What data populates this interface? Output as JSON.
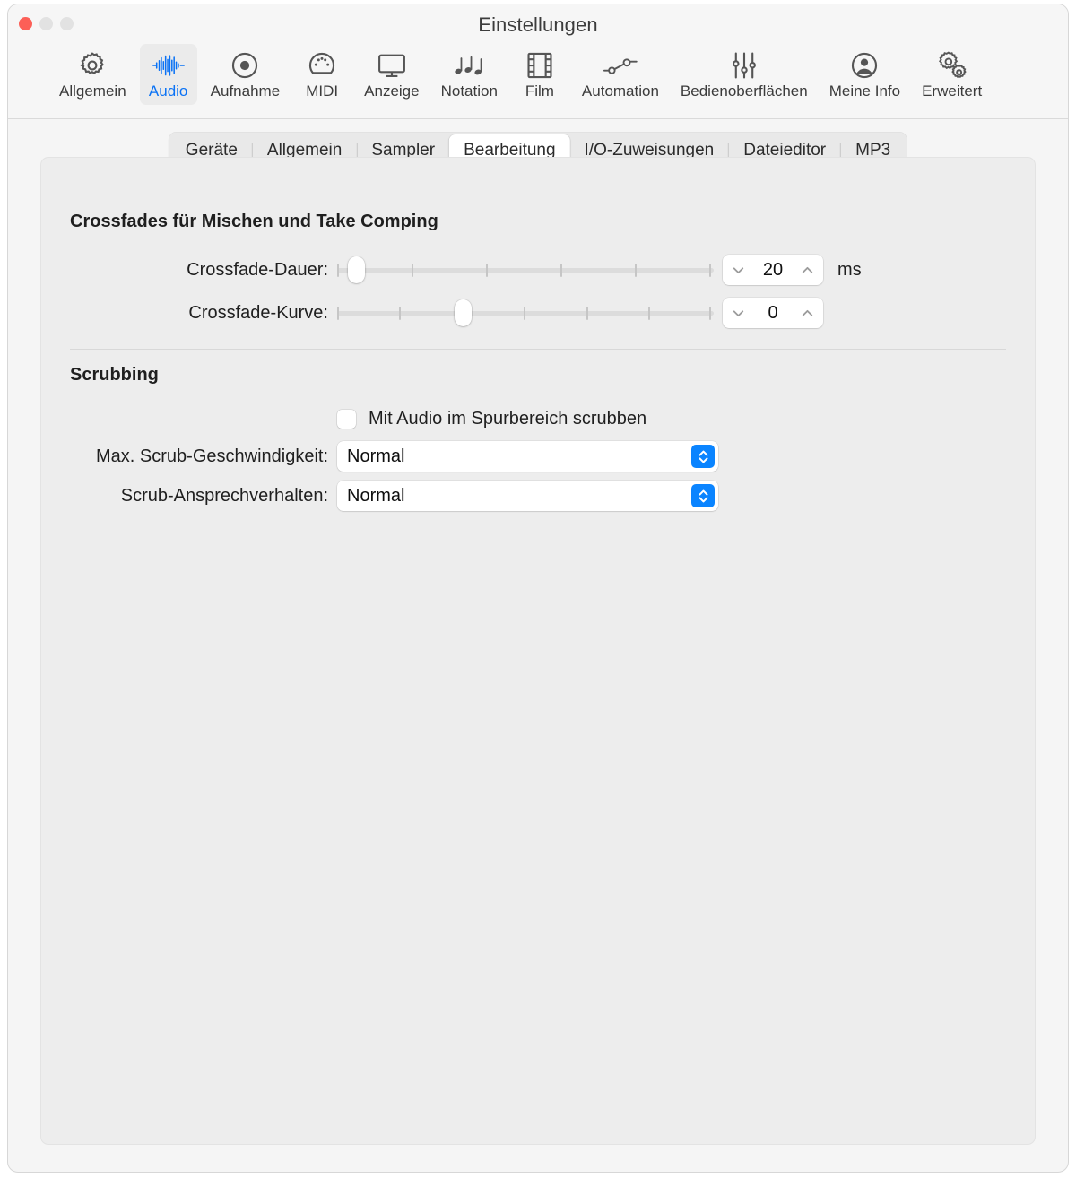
{
  "window": {
    "title": "Einstellungen",
    "traffic_lights": [
      "close",
      "minimize",
      "zoom"
    ]
  },
  "toolbar": {
    "items": [
      {
        "label": "Allgemein",
        "icon": "gear-icon",
        "selected": false
      },
      {
        "label": "Audio",
        "icon": "waveform-icon",
        "selected": true
      },
      {
        "label": "Aufnahme",
        "icon": "record-icon",
        "selected": false
      },
      {
        "label": "MIDI",
        "icon": "midi-connector-icon",
        "selected": false
      },
      {
        "label": "Anzeige",
        "icon": "display-icon",
        "selected": false
      },
      {
        "label": "Notation",
        "icon": "music-notes-icon",
        "selected": false
      },
      {
        "label": "Film",
        "icon": "film-strip-icon",
        "selected": false
      },
      {
        "label": "Automation",
        "icon": "automation-node-icon",
        "selected": false
      },
      {
        "label": "Bedienoberflächen",
        "icon": "faders-icon",
        "selected": false
      },
      {
        "label": "Meine Info",
        "icon": "person-circle-icon",
        "selected": false
      },
      {
        "label": "Erweitert",
        "icon": "double-gear-icon",
        "selected": false
      }
    ]
  },
  "tabs": {
    "items": [
      {
        "label": "Geräte",
        "active": false
      },
      {
        "label": "Allgemein",
        "active": false
      },
      {
        "label": "Sampler",
        "active": false
      },
      {
        "label": "Bearbeitung",
        "active": true
      },
      {
        "label": "I/O-Zuweisungen",
        "active": false
      },
      {
        "label": "Dateieditor",
        "active": false
      },
      {
        "label": "MP3",
        "active": false
      }
    ]
  },
  "sections": {
    "crossfades": {
      "title": "Crossfades für Mischen und Take Comping",
      "duration": {
        "label": "Crossfade-Dauer:",
        "value": "20",
        "unit": "ms",
        "slider_position_percent": 5,
        "slider_ticks": 6,
        "chevron_down": "chevron-down-icon",
        "chevron_up": "chevron-up-icon"
      },
      "curve": {
        "label": "Crossfade-Kurve:",
        "value": "0",
        "unit": "",
        "slider_position_percent": 33,
        "slider_ticks": 7,
        "chevron_down": "chevron-down-icon",
        "chevron_up": "chevron-up-icon"
      }
    },
    "scrubbing": {
      "title": "Scrubbing",
      "checkbox": {
        "label": "Mit Audio im Spurbereich scrubben",
        "checked": false
      },
      "max_speed": {
        "label": "Max. Scrub-Geschwindigkeit:",
        "value": "Normal"
      },
      "response": {
        "label": "Scrub-Ansprechverhalten:",
        "value": "Normal"
      }
    }
  },
  "colors": {
    "accent_blue": "#0a84ff",
    "selected_toolbar_blue": "#0a72f5",
    "close_red": "#fc5f57",
    "panel_bg": "#ededed",
    "window_bg": "#f5f5f5"
  }
}
